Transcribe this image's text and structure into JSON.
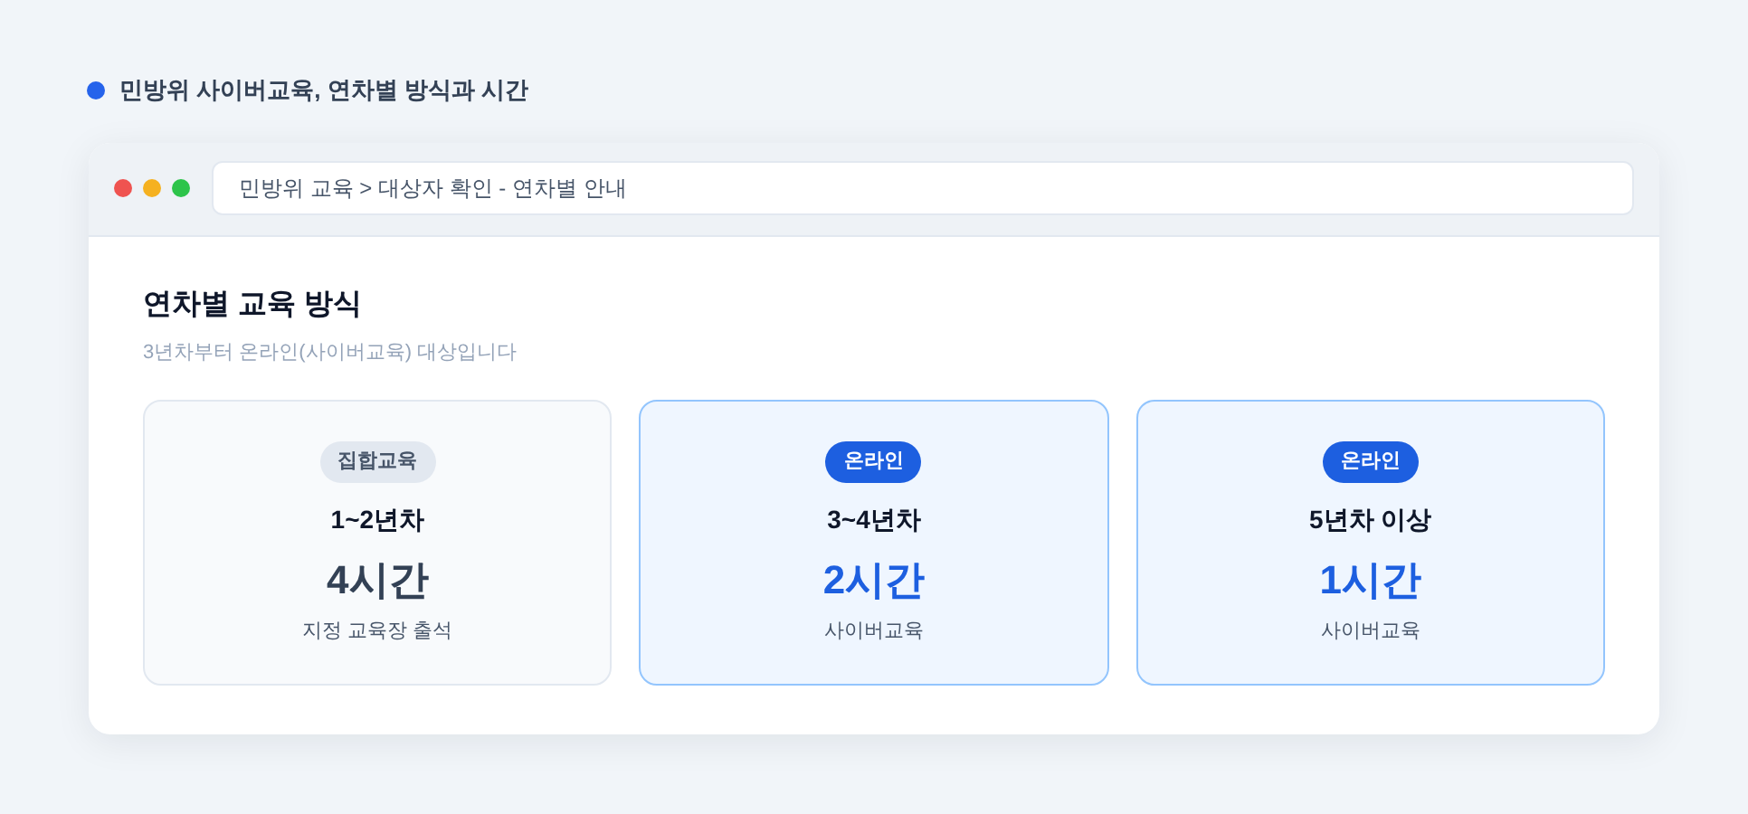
{
  "heading": "민방위 사이버교육, 연차별 방식과 시간",
  "window": {
    "address": "민방위 교육 > 대상자 확인 - 연차별 안내"
  },
  "section": {
    "title": "연차별 교육 방식",
    "subtitle": "3년차부터 온라인(사이버교육) 대상입니다"
  },
  "cards": [
    {
      "kind": "offline",
      "badge": "집합교육",
      "years": "1~2년차",
      "hours": "4시간",
      "method": "지정 교육장 출석"
    },
    {
      "kind": "online",
      "badge": "온라인",
      "years": "3~4년차",
      "hours": "2시간",
      "method": "사이버교육"
    },
    {
      "kind": "online",
      "badge": "온라인",
      "years": "5년차 이상",
      "hours": "1시간",
      "method": "사이버교육"
    }
  ]
}
